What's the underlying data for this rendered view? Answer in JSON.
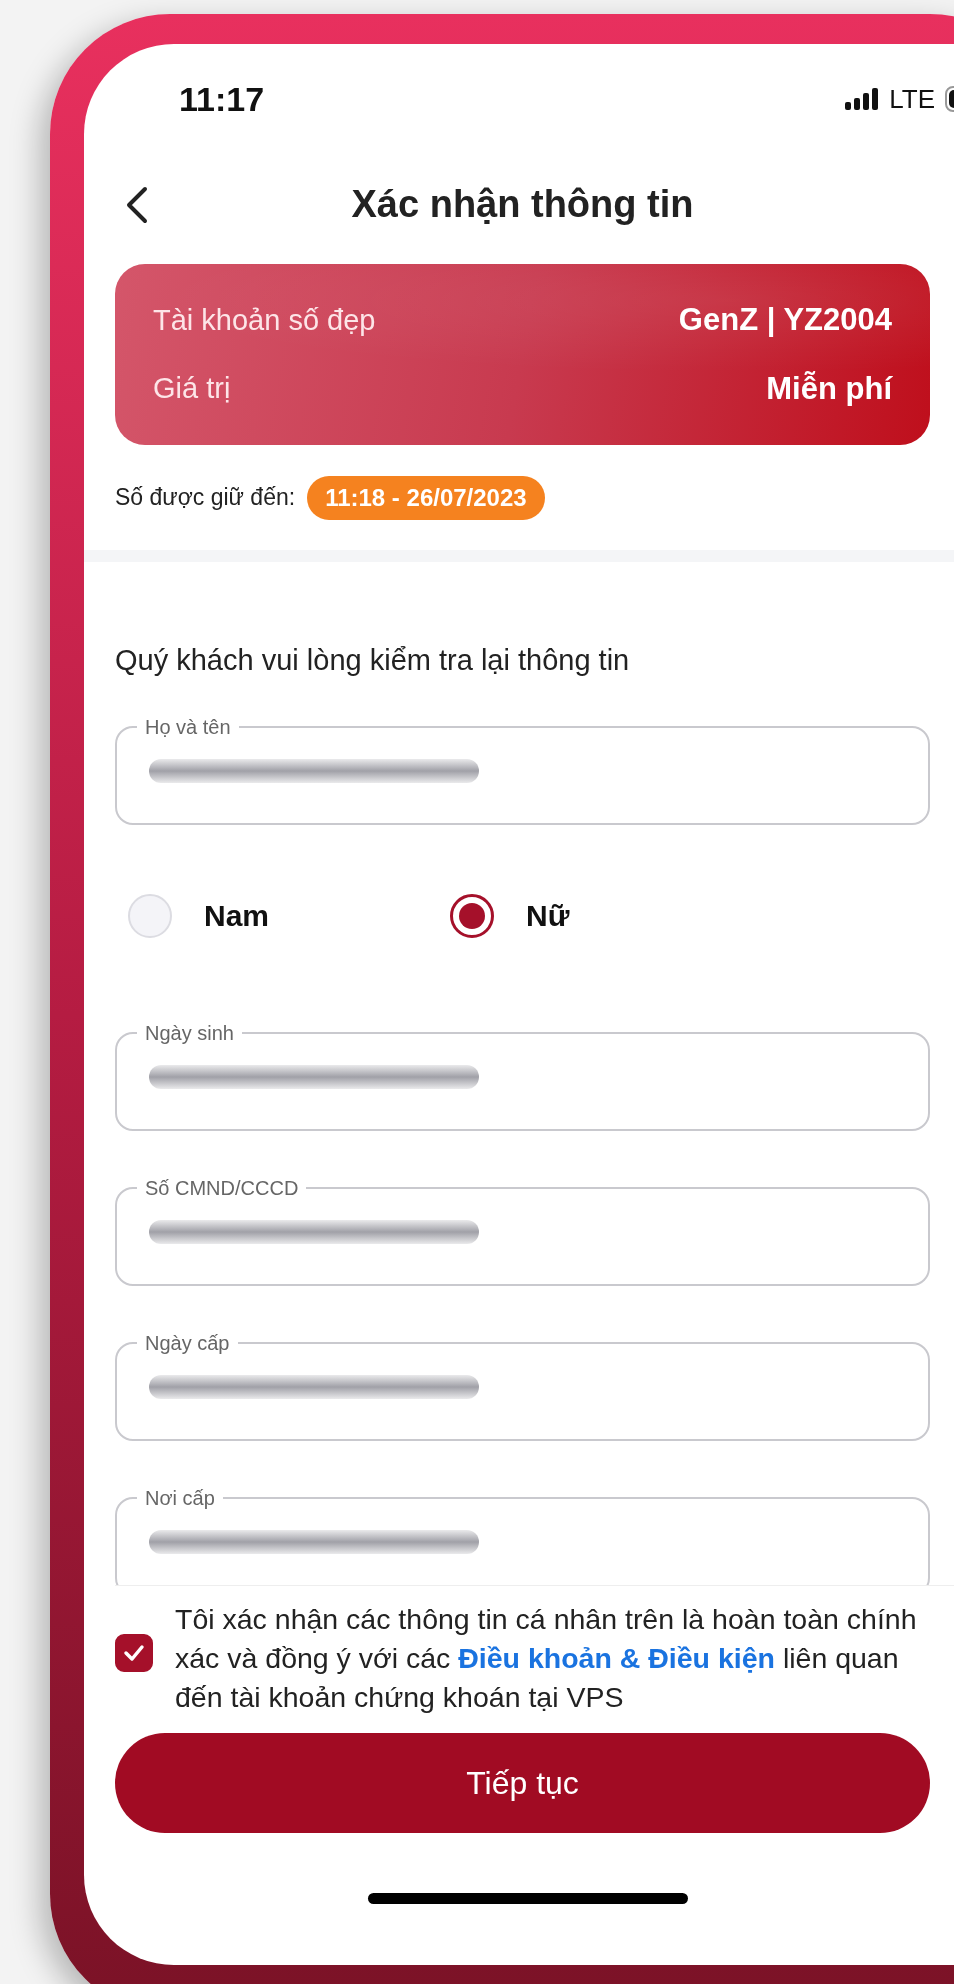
{
  "status_bar": {
    "time": "11:17",
    "network": "LTE"
  },
  "header": {
    "title": "Xác nhận thông tin"
  },
  "account_card": {
    "rows": [
      {
        "label": "Tài khoản số đẹp",
        "value": "GenZ | YZ2004"
      },
      {
        "label": "Giá trị",
        "value": "Miễn phí"
      }
    ]
  },
  "hold": {
    "label": "Số được giữ đến:",
    "value": "11:18 - 26/07/2023"
  },
  "form": {
    "intro": "Quý khách vui lòng kiểm tra lại thông tin",
    "fields": [
      {
        "kind": "text",
        "label": "Họ và tên"
      },
      {
        "kind": "gender",
        "options": [
          {
            "label": "Nam",
            "selected": false
          },
          {
            "label": "Nữ",
            "selected": true
          }
        ]
      },
      {
        "kind": "text",
        "label": "Ngày sinh"
      },
      {
        "kind": "text",
        "label": "Số CMND/CCCD"
      },
      {
        "kind": "text",
        "label": "Ngày cấp"
      },
      {
        "kind": "text",
        "label": "Nơi cấp"
      }
    ]
  },
  "consent": {
    "checked": true,
    "text_before": "Tôi xác nhận các thông tin cá nhân trên là hoàn toàn chính xác và đồng ý với các",
    "link": "Điều khoản & Điều kiện",
    "text_after": "liên quan đến tài khoản chứng khoán tại VPS"
  },
  "continue_button": {
    "label": "Tiếp tục"
  }
}
